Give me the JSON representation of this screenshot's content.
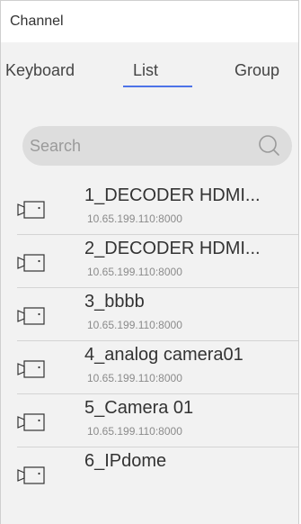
{
  "header": {
    "title": "Channel"
  },
  "tabs": [
    {
      "label": "Keyboard"
    },
    {
      "label": "List"
    },
    {
      "label": "Group"
    }
  ],
  "search": {
    "placeholder": "Search",
    "icon": "search-icon"
  },
  "channels": [
    {
      "name": "1_DECODER HDMI...",
      "address": "10.65.199.110:8000",
      "icon": "camera-icon"
    },
    {
      "name": "2_DECODER HDMI...",
      "address": "10.65.199.110:8000",
      "icon": "camera-icon"
    },
    {
      "name": "3_bbbb",
      "address": "10.65.199.110:8000",
      "icon": "camera-icon"
    },
    {
      "name": "4_analog camera01",
      "address": "10.65.199.110:8000",
      "icon": "camera-icon"
    },
    {
      "name": "5_Camera 01",
      "address": "10.65.199.110:8000",
      "icon": "camera-icon"
    },
    {
      "name": "6_IPdome",
      "address": "",
      "icon": "camera-icon"
    }
  ],
  "colors": {
    "accent": "#4d73e8",
    "background": "#f2f2f2",
    "search_bg": "#dddddd"
  }
}
